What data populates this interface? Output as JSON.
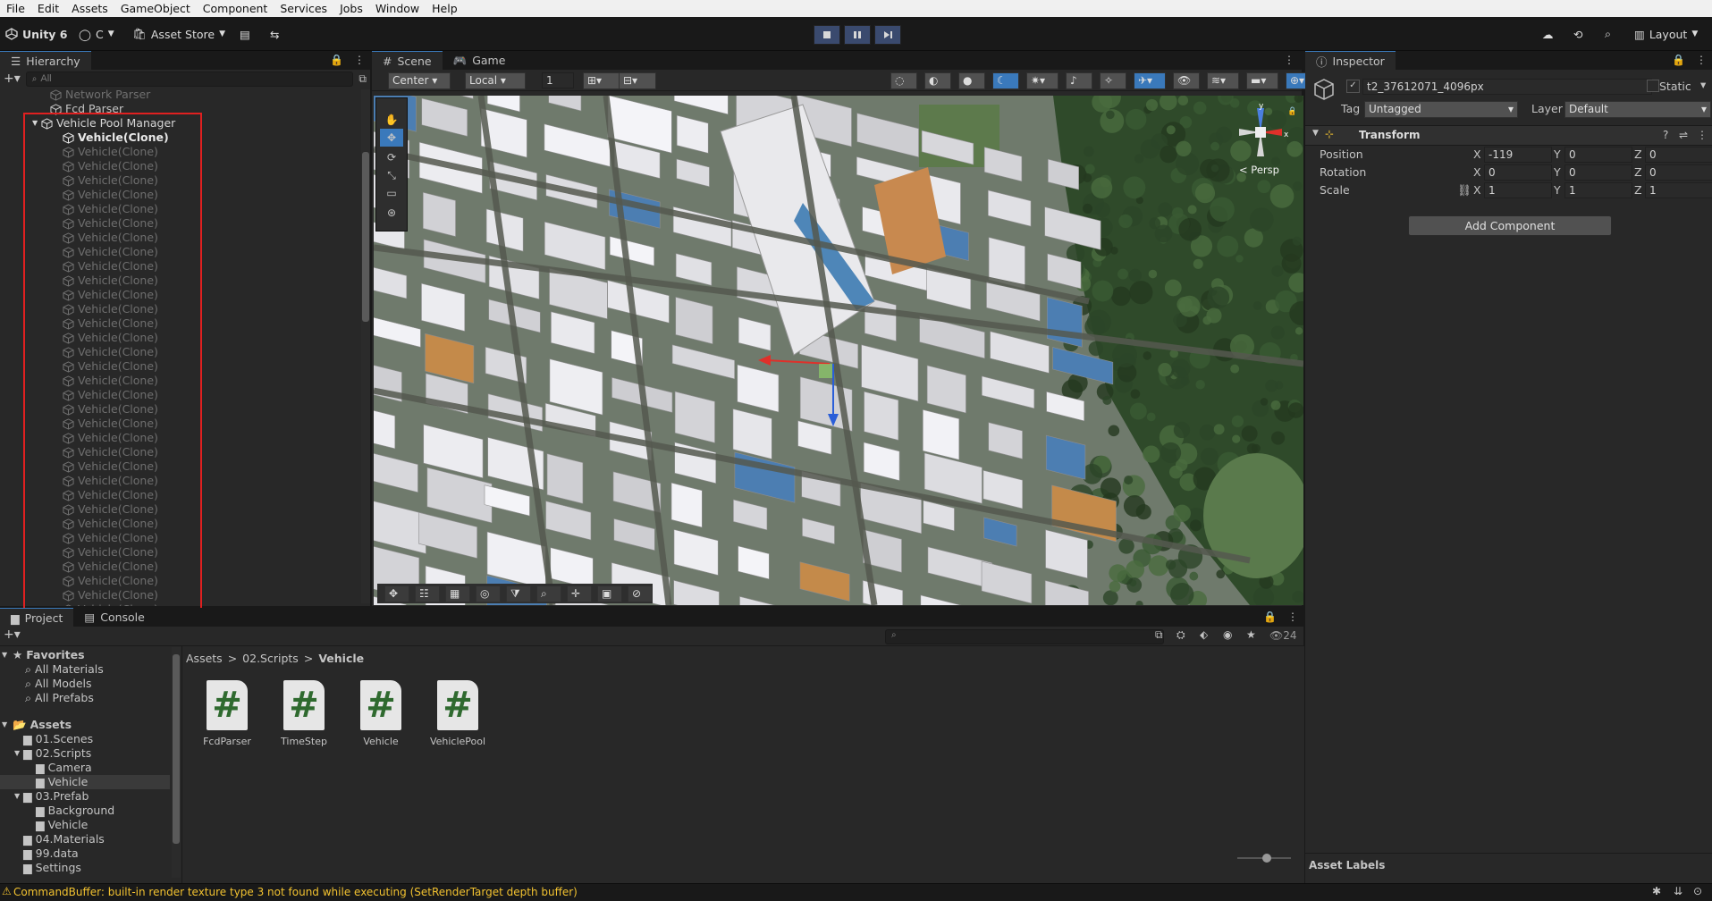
{
  "menu": [
    "File",
    "Edit",
    "Assets",
    "GameObject",
    "Component",
    "Services",
    "Jobs",
    "Window",
    "Help"
  ],
  "toolbar": {
    "account_label": "Unity 6",
    "cloud_label": "C",
    "asset_store_label": "Asset Store",
    "layout_label": "Layout"
  },
  "hierarchy": {
    "tab_label": "Hierarchy",
    "search_placeholder": "All",
    "items_top": [
      "Network Parser",
      "Fcd Parser"
    ],
    "pool_manager": "Vehicle Pool Manager",
    "clone_label": "Vehicle(Clone)"
  },
  "scene": {
    "tabs": [
      "Scene",
      "Game"
    ],
    "pivot_mode": "Center",
    "pivot_rotation": "Local",
    "grid_value": "1",
    "persp_label": "< Persp"
  },
  "inspector": {
    "tab_label": "Inspector",
    "object_name": "t2_37612071_4096px",
    "static_label": "Static",
    "tag_label": "Tag",
    "tag_value": "Untagged",
    "layer_label": "Layer",
    "layer_value": "Default",
    "component_title": "Transform",
    "rows": [
      {
        "label": "Position",
        "x": "-119",
        "y": "0",
        "z": "0"
      },
      {
        "label": "Rotation",
        "x": "0",
        "y": "0",
        "z": "0"
      },
      {
        "label": "Scale",
        "x": "1",
        "y": "1",
        "z": "1"
      }
    ],
    "axis_x": "X",
    "axis_y": "Y",
    "axis_z": "Z",
    "add_component": "Add Component",
    "asset_labels": "Asset Labels"
  },
  "project": {
    "tabs": [
      "Project",
      "Console"
    ],
    "favorites_label": "Favorites",
    "favorites": [
      "All Materials",
      "All Models",
      "All Prefabs"
    ],
    "assets_label": "Assets",
    "tree": [
      {
        "label": "01.Scenes",
        "indent": 1
      },
      {
        "label": "02.Scripts",
        "indent": 1
      },
      {
        "label": "Camera",
        "indent": 2
      },
      {
        "label": "Vehicle",
        "indent": 2
      },
      {
        "label": "03.Prefab",
        "indent": 1
      },
      {
        "label": "Background",
        "indent": 2
      },
      {
        "label": "Vehicle",
        "indent": 2
      },
      {
        "label": "04.Materials",
        "indent": 1
      },
      {
        "label": "99.data",
        "indent": 1
      },
      {
        "label": "Settings",
        "indent": 1
      }
    ],
    "breadcrumb": [
      "Assets",
      "02.Scripts",
      "Vehicle"
    ],
    "hidden_count": "24",
    "files": [
      "FcdParser",
      "TimeStep",
      "Vehicle",
      "VehiclePool"
    ],
    "file_glyph": "#"
  },
  "status": {
    "message": "CommandBuffer: built-in render texture type 3 not found while executing  (SetRenderTarget depth buffer)"
  },
  "colors": {
    "highlight": "#e02020",
    "selection": "#2c5d87",
    "accent": "#3a79bb",
    "warning": "#f2c230"
  }
}
